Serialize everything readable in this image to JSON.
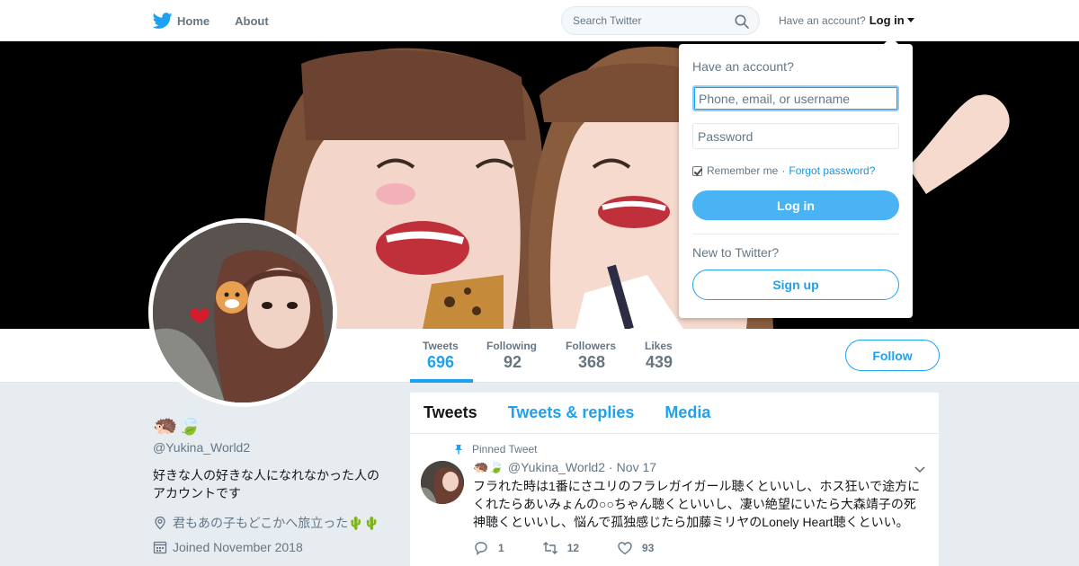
{
  "topbar": {
    "home_label": "Home",
    "about_label": "About",
    "search_placeholder": "Search Twitter",
    "account_prompt": "Have an account?",
    "login_label": "Log in"
  },
  "profile_nav": {
    "stats": [
      {
        "label": "Tweets",
        "value": "696"
      },
      {
        "label": "Following",
        "value": "92"
      },
      {
        "label": "Followers",
        "value": "368"
      },
      {
        "label": "Likes",
        "value": "439"
      }
    ],
    "follow_label": "Follow"
  },
  "profile": {
    "name": "🦔🍃",
    "handle": "@Yukina_World2",
    "description_line1": "好きな人の好きな人になれなかった人の",
    "description_line2": "アカウントです",
    "location": "君もあの子もどこかへ旅立った🌵🌵",
    "joined": "Joined November 2018"
  },
  "timeline": {
    "tabs": [
      "Tweets",
      "Tweets & replies",
      "Media"
    ],
    "tweet": {
      "pinned_label": "Pinned Tweet",
      "author_emoji": "🦔🍃",
      "handle": "@Yukina_World2",
      "separator": "·",
      "date": "Nov 17",
      "text_line1": "フラれた時は1番にさユリのフラレガイガール聴くといいし、ホス狂いで途方に",
      "text_line2": "くれたらあいみょんの○○ちゃん聴くといいし、凄い絶望にいたら大森靖子の死",
      "text_line3": "神聴くといいし、悩んで孤独感じたら加藤ミリヤのLonely Heart聴くといい。",
      "replies": "1",
      "retweets": "12",
      "likes": "93"
    }
  },
  "login_dropdown": {
    "title": "Have an account?",
    "username_placeholder": "Phone, email, or username",
    "password_placeholder": "Password",
    "remember_label": "Remember me",
    "separator": "·",
    "forgot_label": "Forgot password?",
    "login_button": "Log in",
    "new_prompt": "New to Twitter?",
    "signup_button": "Sign up"
  },
  "colors": {
    "accent": "#1da1f2",
    "background": "#e6ecf0",
    "muted_text": "#657786"
  }
}
